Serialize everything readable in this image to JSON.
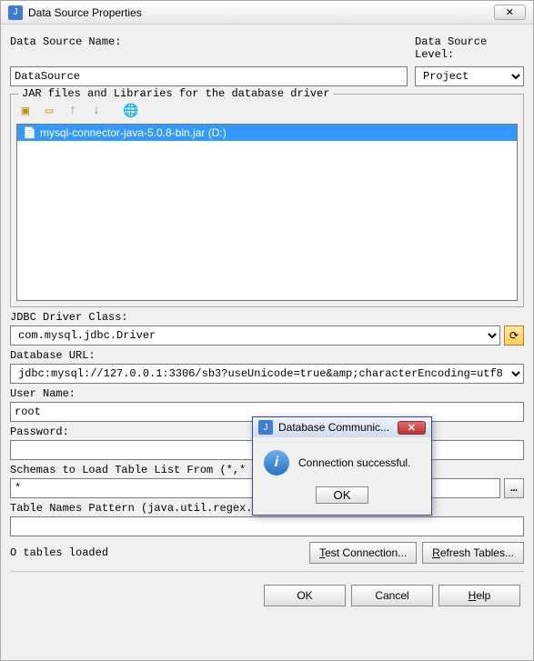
{
  "titlebar": {
    "title": "Data Source Properties"
  },
  "labels": {
    "name": "Data Source Name:",
    "level": "Data Source Level:",
    "jar_legend": "JAR files and Libraries for the database driver",
    "driver_class": "JDBC Driver Class:",
    "db_url": "Database URL:",
    "username": "User Name:",
    "password": "Password:",
    "schemas": "Schemas to Load Table List From (*,* mea",
    "table_pattern": "Table Names Pattern (java.util.regex.Pattern, empty means  .*):"
  },
  "fields": {
    "name": "DataSource",
    "level": "Project",
    "driver_class": "com.mysql.jdbc.Driver",
    "db_url": "jdbc:mysql://127.0.0.1:3306/sb3?useUnicode=true&amp;characterEncoding=utf8",
    "username": "root",
    "password": "",
    "schemas": "*",
    "table_pattern": ""
  },
  "jar_list": [
    {
      "label": "mysql-connector-java-5.0.8-bin.jar (D:)",
      "selected": true
    }
  ],
  "status": {
    "tables_loaded": "O tables loaded"
  },
  "buttons": {
    "test_connection": "Test Connection...",
    "refresh_tables": "Refresh Tables...",
    "ok": "OK",
    "cancel": "Cancel",
    "help": "Help"
  },
  "modal": {
    "title": "Database Communic...",
    "message": "Connection successful.",
    "ok": "OK"
  }
}
